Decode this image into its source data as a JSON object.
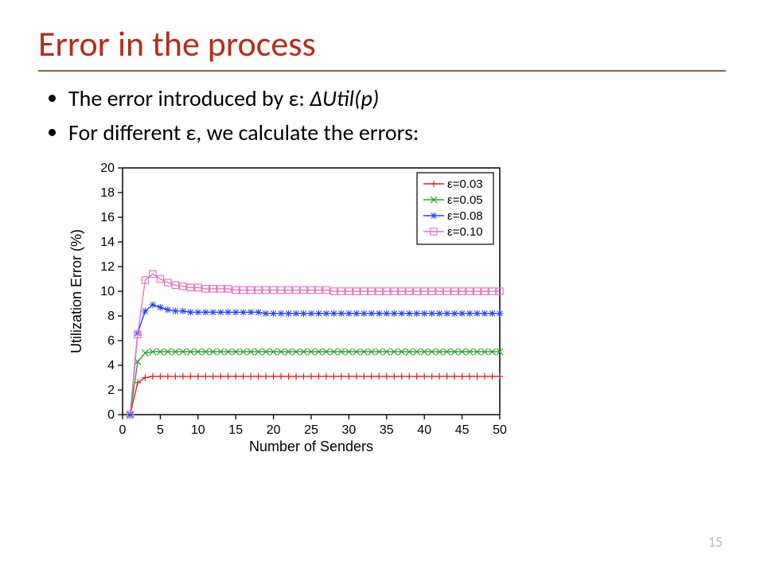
{
  "title": "Error in the process",
  "bullets": {
    "b1_prefix": "The error introduced by ε: ",
    "b1_em": "ΔUtil(p)",
    "b2": "For different ε, we calculate the errors:"
  },
  "page_number": "15",
  "chart_data": {
    "type": "line",
    "xlabel": "Number of Senders",
    "ylabel": "Utilization Error (%)",
    "xlim": [
      0,
      50
    ],
    "ylim": [
      0,
      20
    ],
    "xticks": [
      0,
      5,
      10,
      15,
      20,
      25,
      30,
      35,
      40,
      45,
      50
    ],
    "yticks": [
      0,
      2,
      4,
      6,
      8,
      10,
      12,
      14,
      16,
      18,
      20
    ],
    "grid": false,
    "legend_position": "top-right",
    "legend_box": true,
    "series": [
      {
        "name": "ε=0.03",
        "color": "#d62728",
        "marker": "plus",
        "x": [
          1,
          2,
          3,
          4,
          5,
          6,
          7,
          8,
          9,
          10,
          11,
          12,
          13,
          14,
          15,
          16,
          17,
          18,
          19,
          20,
          21,
          22,
          23,
          24,
          25,
          26,
          27,
          28,
          29,
          30,
          31,
          32,
          33,
          34,
          35,
          36,
          37,
          38,
          39,
          40,
          41,
          42,
          43,
          44,
          45,
          46,
          47,
          48,
          49,
          50
        ],
        "y": [
          0,
          2.6,
          3.0,
          3.1,
          3.1,
          3.1,
          3.1,
          3.1,
          3.1,
          3.1,
          3.1,
          3.1,
          3.1,
          3.1,
          3.1,
          3.1,
          3.1,
          3.1,
          3.1,
          3.1,
          3.1,
          3.1,
          3.1,
          3.1,
          3.1,
          3.1,
          3.1,
          3.1,
          3.1,
          3.1,
          3.1,
          3.1,
          3.1,
          3.1,
          3.1,
          3.1,
          3.1,
          3.1,
          3.1,
          3.1,
          3.1,
          3.1,
          3.1,
          3.1,
          3.1,
          3.1,
          3.1,
          3.1,
          3.1,
          3.1
        ]
      },
      {
        "name": "ε=0.05",
        "color": "#2ca02c",
        "marker": "x",
        "x": [
          1,
          2,
          3,
          4,
          5,
          6,
          7,
          8,
          9,
          10,
          11,
          12,
          13,
          14,
          15,
          16,
          17,
          18,
          19,
          20,
          21,
          22,
          23,
          24,
          25,
          26,
          27,
          28,
          29,
          30,
          31,
          32,
          33,
          34,
          35,
          36,
          37,
          38,
          39,
          40,
          41,
          42,
          43,
          44,
          45,
          46,
          47,
          48,
          49,
          50
        ],
        "y": [
          0,
          4.3,
          5.0,
          5.1,
          5.1,
          5.1,
          5.1,
          5.1,
          5.1,
          5.1,
          5.1,
          5.1,
          5.1,
          5.1,
          5.1,
          5.1,
          5.1,
          5.1,
          5.1,
          5.1,
          5.1,
          5.1,
          5.1,
          5.1,
          5.1,
          5.1,
          5.1,
          5.1,
          5.1,
          5.1,
          5.1,
          5.1,
          5.1,
          5.1,
          5.1,
          5.1,
          5.1,
          5.1,
          5.1,
          5.1,
          5.1,
          5.1,
          5.1,
          5.1,
          5.1,
          5.1,
          5.1,
          5.1,
          5.1,
          5.1
        ]
      },
      {
        "name": "ε=0.08",
        "color": "#1f3fff",
        "marker": "star",
        "x": [
          1,
          2,
          3,
          4,
          5,
          6,
          7,
          8,
          9,
          10,
          11,
          12,
          13,
          14,
          15,
          16,
          17,
          18,
          19,
          20,
          21,
          22,
          23,
          24,
          25,
          26,
          27,
          28,
          29,
          30,
          31,
          32,
          33,
          34,
          35,
          36,
          37,
          38,
          39,
          40,
          41,
          42,
          43,
          44,
          45,
          46,
          47,
          48,
          49,
          50
        ],
        "y": [
          0,
          6.6,
          8.4,
          8.9,
          8.7,
          8.5,
          8.4,
          8.4,
          8.3,
          8.3,
          8.3,
          8.3,
          8.3,
          8.3,
          8.3,
          8.3,
          8.3,
          8.3,
          8.2,
          8.2,
          8.2,
          8.2,
          8.2,
          8.2,
          8.2,
          8.2,
          8.2,
          8.2,
          8.2,
          8.2,
          8.2,
          8.2,
          8.2,
          8.2,
          8.2,
          8.2,
          8.2,
          8.2,
          8.2,
          8.2,
          8.2,
          8.2,
          8.2,
          8.2,
          8.2,
          8.2,
          8.2,
          8.2,
          8.2,
          8.2
        ]
      },
      {
        "name": "ε=0.10",
        "color": "#e377c2",
        "marker": "square",
        "x": [
          1,
          2,
          3,
          4,
          5,
          6,
          7,
          8,
          9,
          10,
          11,
          12,
          13,
          14,
          15,
          16,
          17,
          18,
          19,
          20,
          21,
          22,
          23,
          24,
          25,
          26,
          27,
          28,
          29,
          30,
          31,
          32,
          33,
          34,
          35,
          36,
          37,
          38,
          39,
          40,
          41,
          42,
          43,
          44,
          45,
          46,
          47,
          48,
          49,
          50
        ],
        "y": [
          0,
          6.5,
          10.9,
          11.4,
          11.0,
          10.7,
          10.5,
          10.4,
          10.3,
          10.3,
          10.2,
          10.2,
          10.2,
          10.2,
          10.1,
          10.1,
          10.1,
          10.1,
          10.1,
          10.1,
          10.1,
          10.1,
          10.1,
          10.1,
          10.1,
          10.1,
          10.1,
          10.0,
          10.0,
          10.0,
          10.0,
          10.0,
          10.0,
          10.0,
          10.0,
          10.0,
          10.0,
          10.0,
          10.0,
          10.0,
          10.0,
          10.0,
          10.0,
          10.0,
          10.0,
          10.0,
          10.0,
          10.0,
          10.0,
          10.0
        ]
      }
    ]
  }
}
